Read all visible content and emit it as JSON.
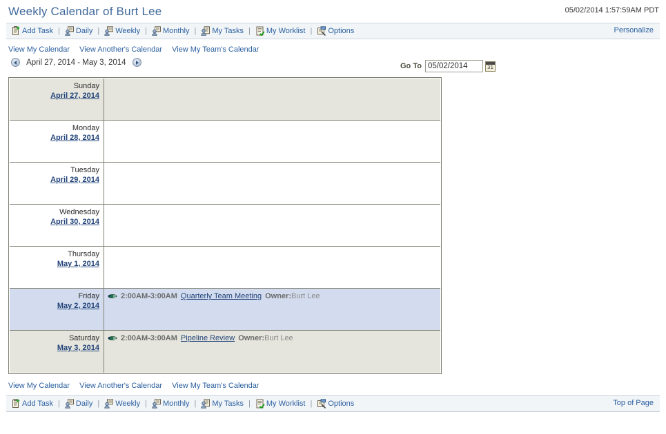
{
  "header": {
    "title": "Weekly Calendar of Burt Lee",
    "timestamp": "05/02/2014 1:57:59AM PDT"
  },
  "toolbar": {
    "personalize_label": "Personalize",
    "top_of_page_label": "Top of Page",
    "separator": "|",
    "items": [
      {
        "label": "Add Task",
        "icon": "add-task-icon"
      },
      {
        "label": "Daily",
        "icon": "daily-icon"
      },
      {
        "label": "Weekly",
        "icon": "weekly-icon"
      },
      {
        "label": "Monthly",
        "icon": "monthly-icon"
      },
      {
        "label": "My Tasks",
        "icon": "my-tasks-icon"
      },
      {
        "label": "My Worklist",
        "icon": "my-worklist-icon"
      },
      {
        "label": "Options",
        "icon": "options-icon"
      }
    ]
  },
  "view_links": [
    {
      "label": "View My Calendar"
    },
    {
      "label": "View Another's Calendar"
    },
    {
      "label": "View My Team's Calendar"
    }
  ],
  "weeknav": {
    "prev_icon": "previous-week-arrow-icon",
    "next_icon": "next-week-arrow-icon",
    "range": "April 27, 2014 - May 3, 2014",
    "goto_label": "Go To",
    "goto_value": "05/02/2014",
    "goto_placeholder": "MM/DD/YYYY",
    "calendar_icon": "calendar-picker-icon"
  },
  "calendar": {
    "rows": [
      {
        "dayname": "Sunday",
        "date": "April 27, 2014",
        "style": "row-weekend",
        "events": []
      },
      {
        "dayname": "Monday",
        "date": "April 28, 2014",
        "style": "row-plain",
        "events": []
      },
      {
        "dayname": "Tuesday",
        "date": "April 29, 2014",
        "style": "row-plain",
        "events": []
      },
      {
        "dayname": "Wednesday",
        "date": "April 30, 2014",
        "style": "row-plain",
        "events": []
      },
      {
        "dayname": "Thursday",
        "date": "May 1, 2014",
        "style": "row-plain",
        "events": []
      },
      {
        "dayname": "Friday",
        "date": "May 2, 2014",
        "style": "row-today",
        "events": [
          {
            "icon": "meeting-icon",
            "time": "2:00AM-3:00AM",
            "name": "Quarterly Team Meeting",
            "owner_label": "Owner:",
            "owner": "Burt Lee"
          }
        ]
      },
      {
        "dayname": "Saturday",
        "date": "May 3, 2014",
        "style": "row-weekend",
        "events": [
          {
            "icon": "meeting-icon",
            "time": "2:00AM-3:00AM",
            "name": "Pipeline Review",
            "owner_label": "Owner:",
            "owner": "Burt Lee"
          }
        ]
      }
    ]
  },
  "colors": {
    "title": "#406a9a",
    "link": "#2b5f9e",
    "toolbar_bg": "#f1f5f8",
    "weekend_row": "#e5e5dd",
    "today_row": "#d3dcee",
    "grid_border": "#7f7f74"
  }
}
